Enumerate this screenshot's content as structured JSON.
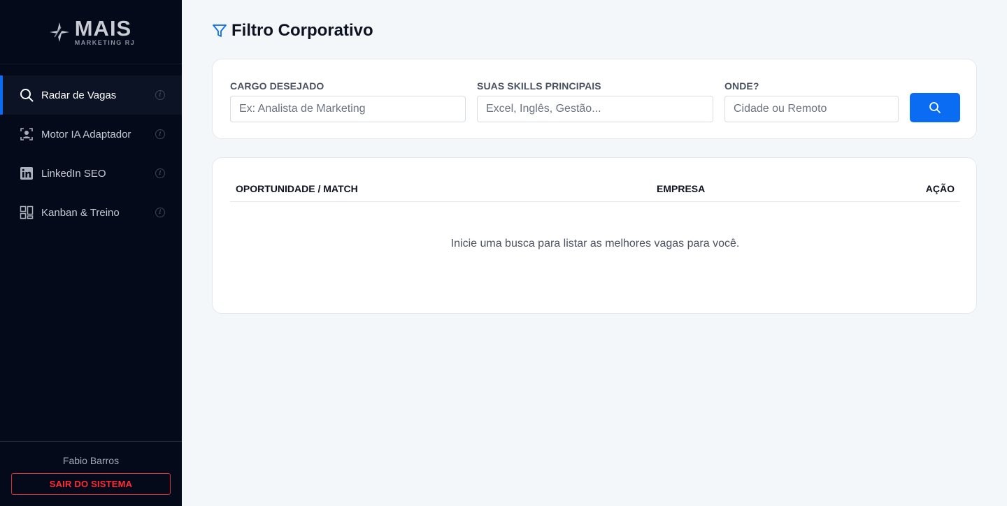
{
  "brand": {
    "name": "MAIS",
    "tagline": "MARKETING RJ"
  },
  "sidebar": {
    "items": [
      {
        "label": "Radar de Vagas",
        "icon": "search-icon",
        "active": true
      },
      {
        "label": "Motor IA Adaptador",
        "icon": "user-frame-icon",
        "active": false
      },
      {
        "label": "LinkedIn SEO",
        "icon": "linkedin-icon",
        "active": false
      },
      {
        "label": "Kanban & Treino",
        "icon": "grid-icon",
        "active": false
      }
    ],
    "user_name": "Fabio Barros",
    "logout_label": "SAIR DO SISTEMA"
  },
  "page": {
    "title": "Filtro Corporativo",
    "title_icon": "filter-icon"
  },
  "filters": {
    "cargo": {
      "label": "CARGO DESEJADO",
      "placeholder": "Ex: Analista de Marketing",
      "value": ""
    },
    "skills": {
      "label": "SUAS SKILLS PRINCIPAIS",
      "placeholder": "Excel, Inglês, Gestão...",
      "value": ""
    },
    "onde": {
      "label": "ONDE?",
      "placeholder": "Cidade ou Remoto",
      "value": ""
    },
    "search_icon": "search-icon"
  },
  "results": {
    "columns": [
      "OPORTUNIDADE / MATCH",
      "EMPRESA",
      "AÇÃO"
    ],
    "empty_message": "Inicie uma busca para listar as melhores vagas para você."
  },
  "colors": {
    "sidebar_bg": "#050a1a",
    "accent": "#0a6cf2",
    "danger": "#ff2b36",
    "page_bg": "#f4f7fa"
  }
}
